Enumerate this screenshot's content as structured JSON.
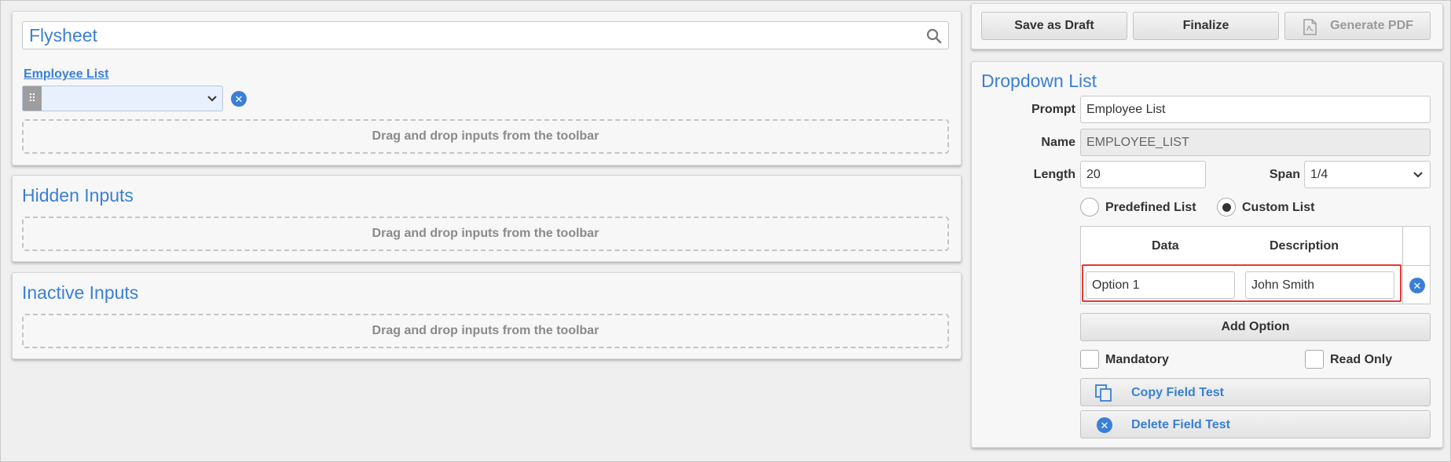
{
  "form": {
    "title": "Flysheet",
    "field_label": "Employee List",
    "select_value": "",
    "dropzone_text": "Drag and drop inputs from the toolbar"
  },
  "hidden_inputs": {
    "title": "Hidden Inputs",
    "dropzone_text": "Drag and drop inputs from the toolbar"
  },
  "inactive_inputs": {
    "title": "Inactive Inputs",
    "dropzone_text": "Drag and drop inputs from the toolbar"
  },
  "toolbar": {
    "save_draft_label": "Save as Draft",
    "finalize_label": "Finalize",
    "generate_pdf_label": "Generate PDF"
  },
  "properties": {
    "title": "Dropdown List",
    "prompt_label": "Prompt",
    "prompt_value": "Employee List",
    "name_label": "Name",
    "name_value": "EMPLOYEE_LIST",
    "length_label": "Length",
    "length_value": "20",
    "span_label": "Span",
    "span_value": "1/4",
    "list_type_options": [
      {
        "label": "Predefined List",
        "selected": false
      },
      {
        "label": "Custom List",
        "selected": true
      }
    ],
    "table_headers": {
      "data": "Data",
      "description": "Description"
    },
    "rows": [
      {
        "data": "Option 1",
        "description": "John Smith"
      }
    ],
    "add_option_label": "Add Option",
    "mandatory_label": "Mandatory",
    "mandatory_checked": false,
    "read_only_label": "Read Only",
    "read_only_checked": false,
    "copy_label": "Copy Field Test",
    "delete_label": "Delete Field Test"
  },
  "colors": {
    "accent": "#3a7fd5",
    "highlight": "#e53935"
  },
  "icons": [
    "search-icon",
    "drag-handle-icon",
    "chevron-down-icon",
    "remove-icon",
    "pdf-icon",
    "copy-icon",
    "delete-icon"
  ]
}
